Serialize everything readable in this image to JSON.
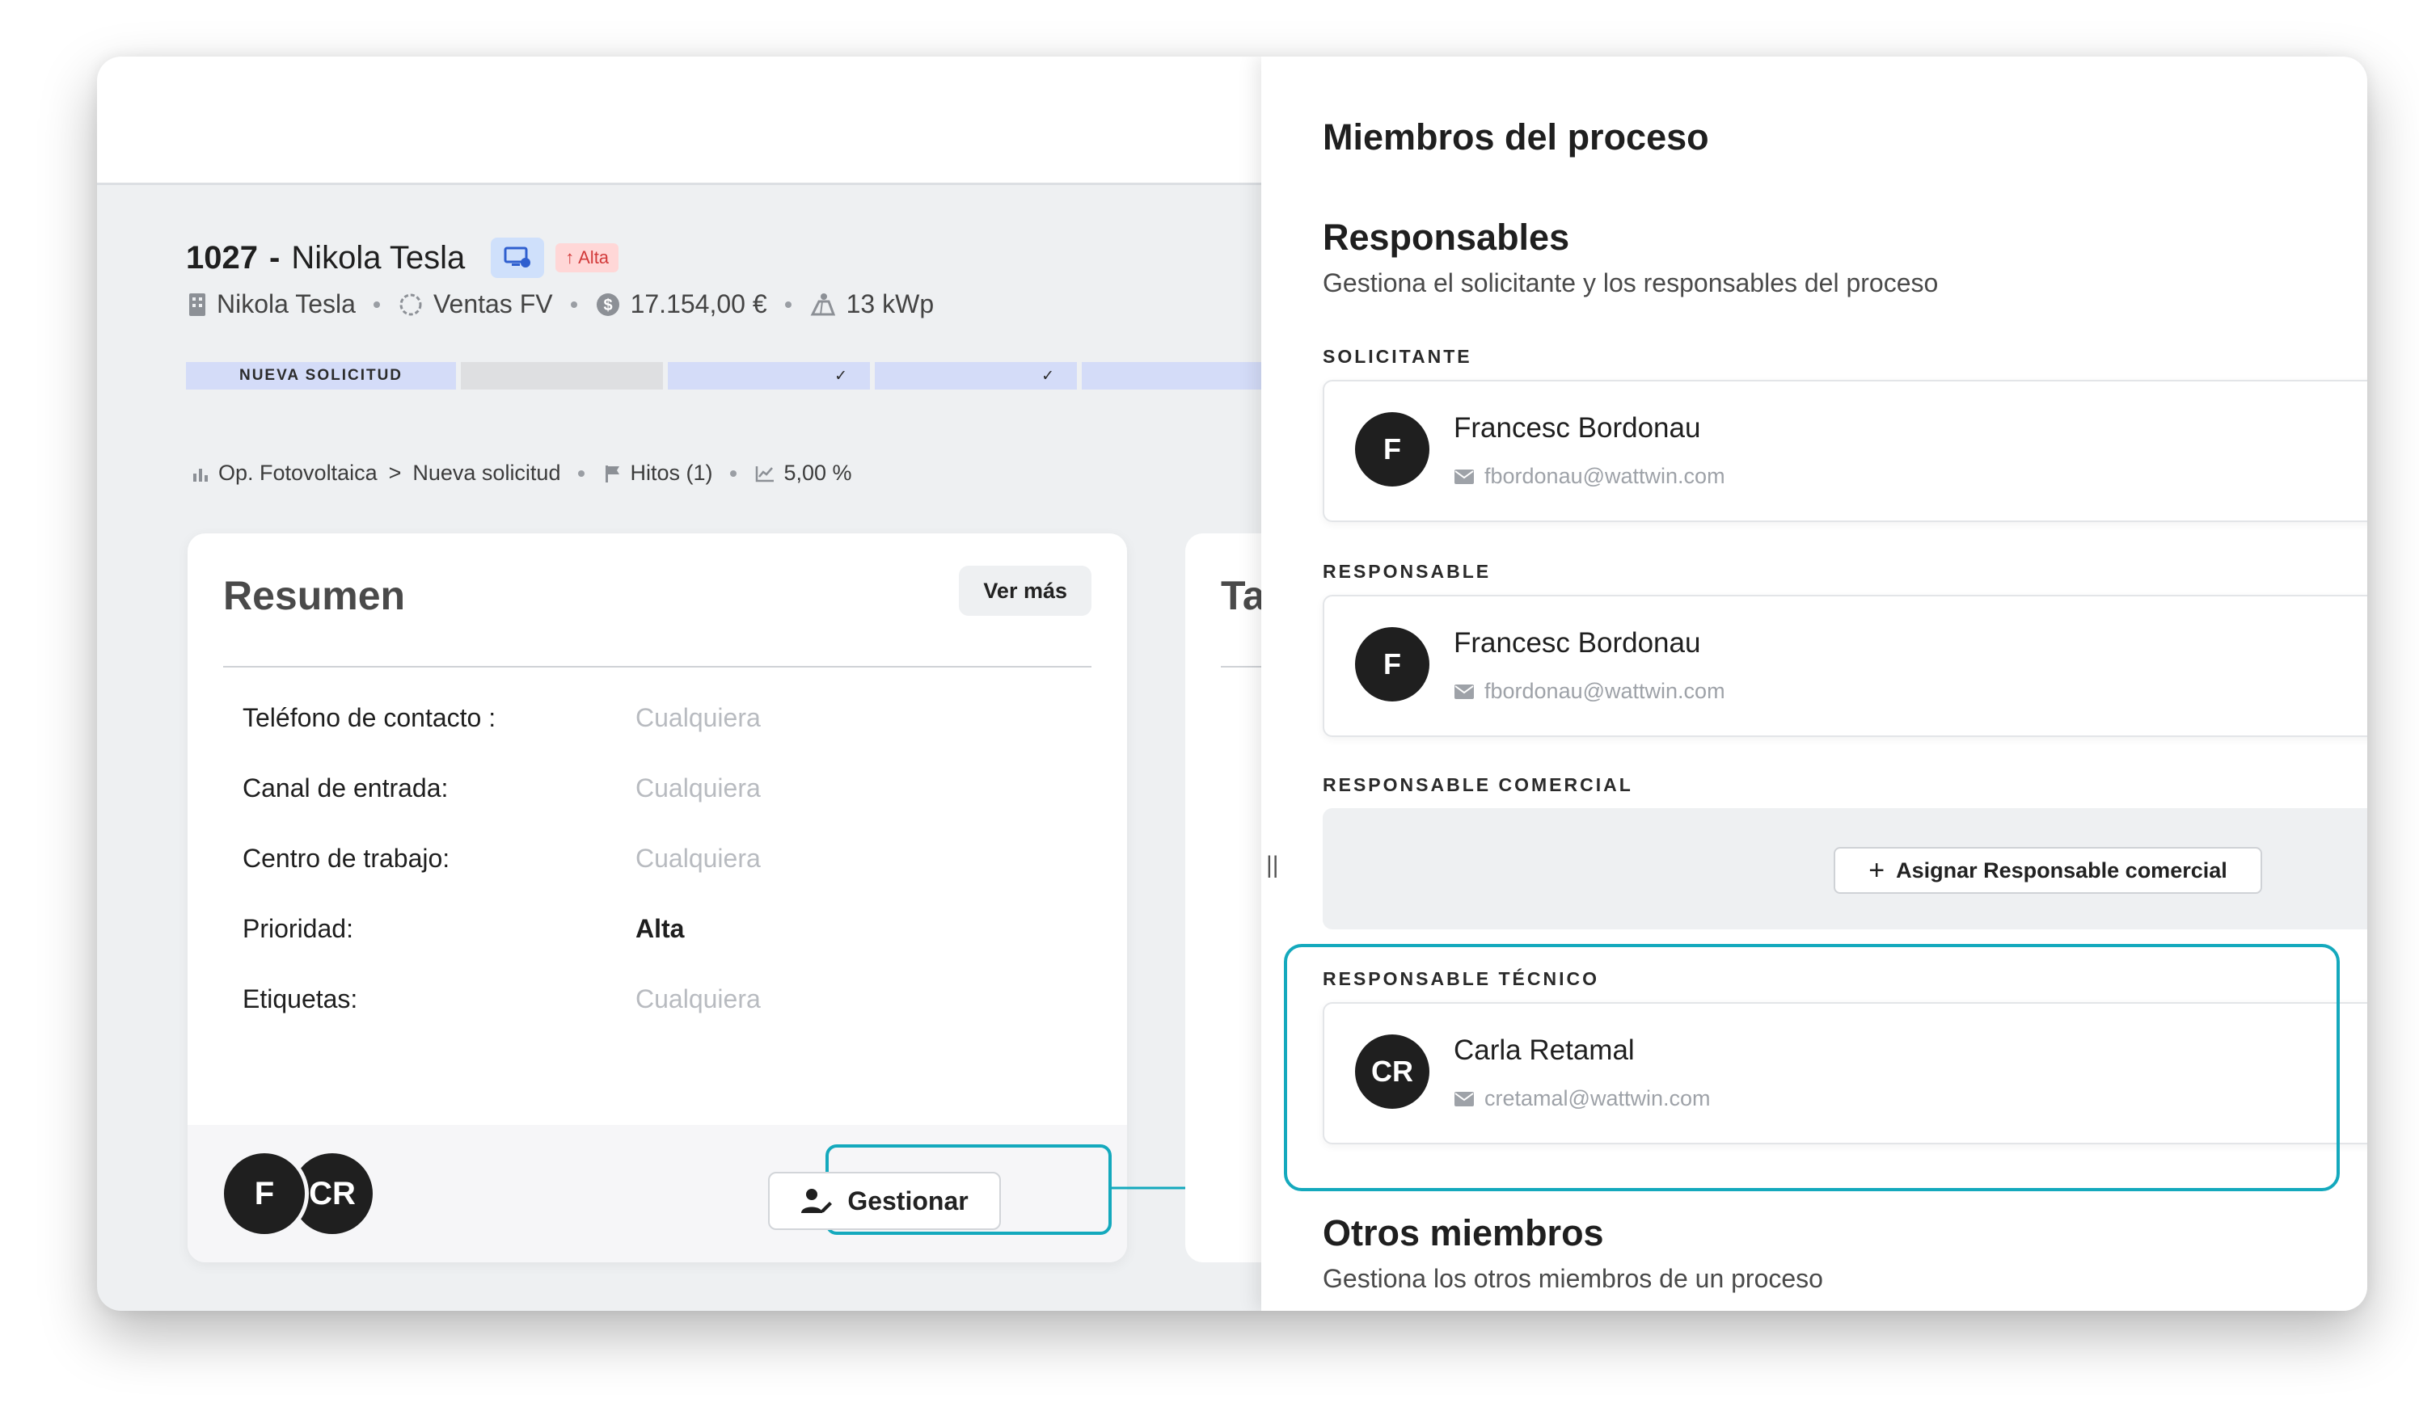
{
  "process": {
    "id": "1027",
    "separator": "-",
    "name": "Nikola Tesla",
    "priority_badge": "↑ Alta",
    "meta": {
      "client": "Nikola Tesla",
      "pipeline": "Ventas FV",
      "amount": "17.154,00 €",
      "power": "13 kWp"
    },
    "stages": {
      "active": "NUEVA SOLICITUD",
      "check": "✓"
    },
    "breadcrumb": {
      "type": "Op. Fotovoltaica",
      "chevron": ">",
      "stage": "Nueva solicitud",
      "milestones": "Hitos (1)",
      "probability": "5,00 %"
    }
  },
  "summary": {
    "title": "Resumen",
    "more_button": "Ver más",
    "rows": [
      {
        "label": "Teléfono de contacto :",
        "value": "Cualquiera"
      },
      {
        "label": "Canal de entrada:",
        "value": "Cualquiera"
      },
      {
        "label": "Centro de trabajo:",
        "value": "Cualquiera"
      },
      {
        "label": "Prioridad:",
        "value": "Alta"
      },
      {
        "label": "Etiquetas:",
        "value": "Cualquiera"
      }
    ],
    "avatars": [
      "F",
      "CR"
    ],
    "manage_button": "Gestionar"
  },
  "second_card": {
    "title_fragment": "Ta"
  },
  "panel": {
    "handle": "||",
    "title": "Miembros del proceso",
    "responsables": {
      "title": "Responsables",
      "subtitle": "Gestiona el solicitante y los responsables del proceso"
    },
    "solicitante": {
      "label": "SOLICITANTE",
      "initials": "F",
      "name": "Francesc Bordonau",
      "email": "fbordonau@wattwin.com"
    },
    "responsable": {
      "label": "RESPONSABLE",
      "initials": "F",
      "name": "Francesc Bordonau",
      "email": "fbordonau@wattwin.com"
    },
    "responsable_comercial": {
      "label": "RESPONSABLE COMERCIAL",
      "assign_button": "Asignar Responsable comercial"
    },
    "responsable_tecnico": {
      "label": "RESPONSABLE TÉCNICO",
      "initials": "CR",
      "name": "Carla Retamal",
      "email": "cretamal@wattwin.com"
    },
    "otros": {
      "title": "Otros miembros",
      "subtitle": "Gestiona los otros miembros de un proceso"
    }
  },
  "colors": {
    "highlight": "#14a9bd",
    "alta_text": "#d23a3a",
    "alta_bg": "#ffd7d7",
    "stage_active": "#d4dcf8"
  }
}
